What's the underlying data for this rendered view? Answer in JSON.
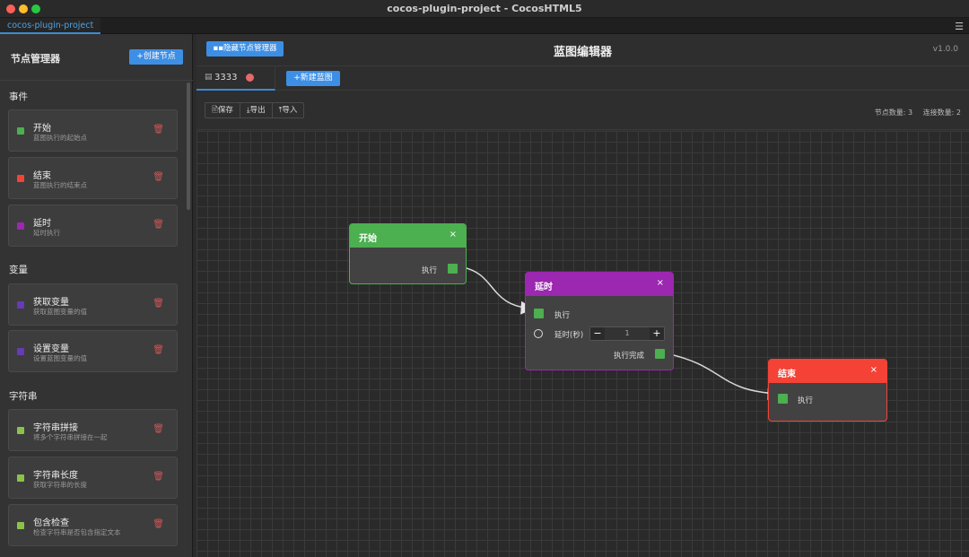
{
  "window": {
    "title": "cocos-plugin-project - CocosHTML5",
    "project_tab": "cocos-plugin-project"
  },
  "sidebar": {
    "title": "节点管理器",
    "create_button": "+创建节点",
    "sections": [
      {
        "title": "事件",
        "items": [
          {
            "name": "开始",
            "desc": "蓝图执行的起始点",
            "color": "#4caf50"
          },
          {
            "name": "结束",
            "desc": "蓝图执行的结束点",
            "color": "#f44336"
          },
          {
            "name": "延时",
            "desc": "延时执行",
            "color": "#9c27b0"
          }
        ]
      },
      {
        "title": "变量",
        "items": [
          {
            "name": "获取变量",
            "desc": "获取蓝图变量的值",
            "color": "#673ab7"
          },
          {
            "name": "设置变量",
            "desc": "设置蓝图变量的值",
            "color": "#673ab7"
          }
        ]
      },
      {
        "title": "字符串",
        "items": [
          {
            "name": "字符串拼接",
            "desc": "将多个字符串拼接在一起",
            "color": "#8bc34a"
          },
          {
            "name": "字符串长度",
            "desc": "获取字符串的长度",
            "color": "#8bc34a"
          },
          {
            "name": "包含检查",
            "desc": "检查字符串是否包含指定文本",
            "color": "#8bc34a"
          }
        ]
      }
    ]
  },
  "header": {
    "hide_button": "隐藏节点管理器",
    "title": "蓝图编辑器",
    "version": "v1.0.0"
  },
  "tabs": {
    "active_label": "3333",
    "new_button": "+新建蓝图"
  },
  "toolbar": {
    "save": "保存",
    "export": "导出",
    "import": "导入",
    "node_count": "节点数量: 3",
    "link_count": "连接数量: 2"
  },
  "nodes": {
    "start": {
      "title": "开始",
      "close": "×",
      "out_label": "执行",
      "color": "#4caf50"
    },
    "delay": {
      "title": "延时",
      "close": "×",
      "in_label": "执行",
      "param_label": "延时(秒)",
      "param_value": "1",
      "minus": "−",
      "plus": "+",
      "out_label": "执行完成",
      "color": "#9c27b0"
    },
    "end": {
      "title": "结束",
      "close": "×",
      "in_label": "执行",
      "color": "#f44336"
    }
  }
}
